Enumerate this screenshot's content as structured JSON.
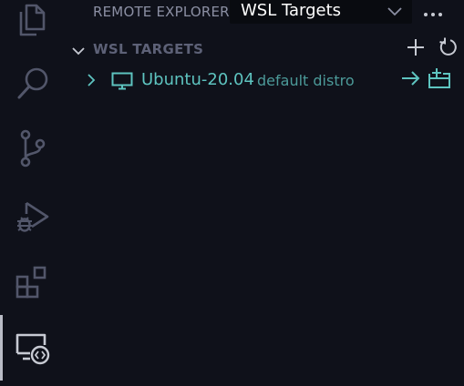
{
  "header": {
    "label": "REMOTE EXPLORER",
    "select_value": "WSL Targets",
    "more_icon": "ellipsis-icon"
  },
  "section": {
    "title": "WSL TARGETS",
    "actions": [
      "add-icon",
      "refresh-icon"
    ]
  },
  "targets": [
    {
      "name": "Ubuntu-20.04",
      "description": "default distro",
      "icon": "monitor-icon",
      "actions": [
        "connect-icon",
        "open-new-window-icon"
      ]
    }
  ],
  "activity_bar": {
    "items": [
      "explorer-icon",
      "search-icon",
      "source-control-icon",
      "run-debug-icon",
      "extensions-icon",
      "remote-explorer-icon"
    ],
    "active": "remote-explorer-icon"
  },
  "colors": {
    "background": "#0f111a",
    "accent": "#5ec4c0",
    "icon": "#52566a"
  }
}
